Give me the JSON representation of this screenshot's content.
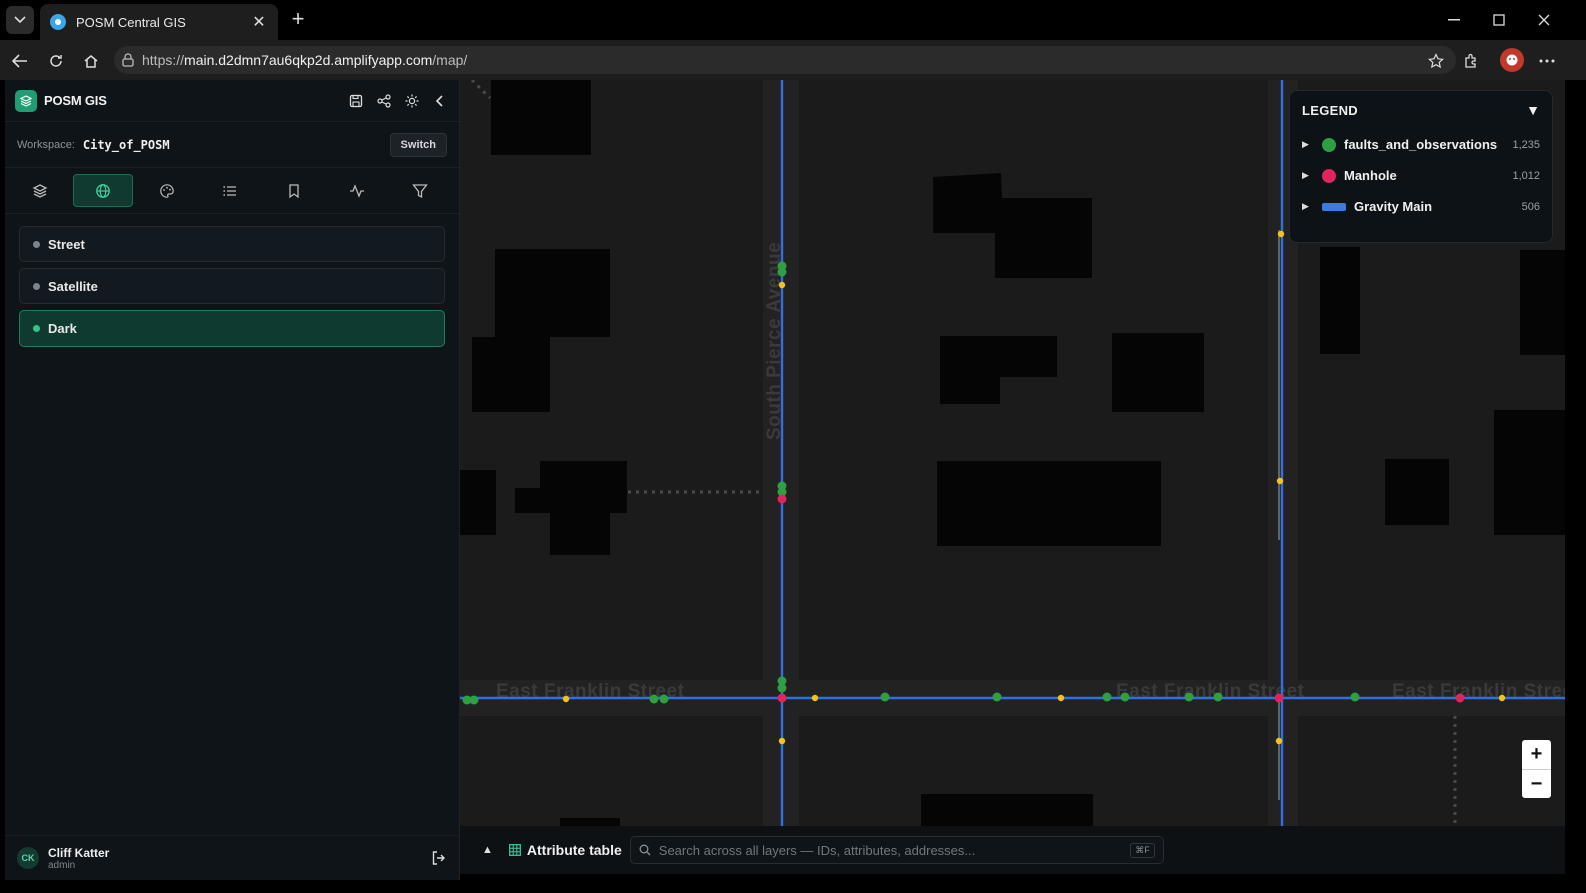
{
  "browser": {
    "tab_title": "POSM Central GIS",
    "url_prefix": "https://",
    "url_host": "main.d2dmn7au6qkp2d.amplifyapp.com",
    "url_path": "/map/"
  },
  "app": {
    "name": "POSM GIS",
    "workspace_label": "Workspace:",
    "workspace_value": "City_of_POSM",
    "switch_label": "Switch"
  },
  "toolbar": {
    "tools": [
      "layers-icon",
      "globe-icon",
      "palette-icon",
      "list-icon",
      "bookmark-icon",
      "activity-icon",
      "filter-icon"
    ],
    "active": "globe-icon"
  },
  "basemaps": [
    {
      "label": "Street",
      "active": false
    },
    {
      "label": "Satellite",
      "active": false
    },
    {
      "label": "Dark",
      "active": true
    }
  ],
  "user": {
    "initials": "CK",
    "name": "Cliff Katter",
    "role": "admin"
  },
  "legend": {
    "title": "LEGEND",
    "items": [
      {
        "name": "faults_and_observations",
        "count": "1,235",
        "color": "#2ea043",
        "shape": "dot"
      },
      {
        "name": "Manhole",
        "count": "1,012",
        "color": "#e0245e",
        "shape": "dot"
      },
      {
        "name": "Gravity Main",
        "count": "506",
        "color": "#3b7ddd",
        "shape": "line"
      }
    ]
  },
  "map": {
    "street_labels": {
      "pierce": "South Pierce Avenue",
      "franklin": "East Franklin Street"
    },
    "colors": {
      "main": "#2f6fe0",
      "fault": "#2ea043",
      "manhole": "#e0245e",
      "node": "#f2c318"
    }
  },
  "bottombar": {
    "title": "Attribute table",
    "search_placeholder": "Search across all layers — IDs, attributes, addresses...",
    "shortcut": "⌘F"
  }
}
